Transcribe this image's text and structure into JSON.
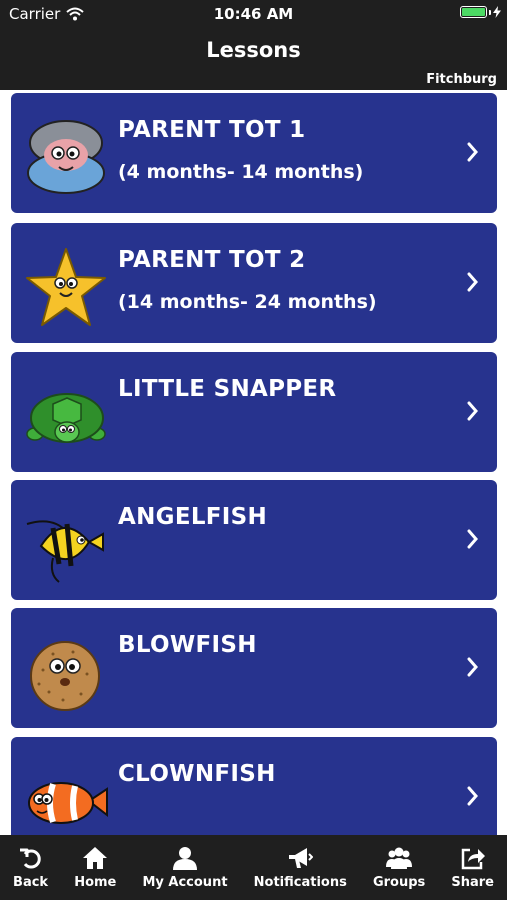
{
  "status_bar": {
    "carrier": "Carrier",
    "time": "10:46 AM",
    "battery_color": "#4cd964"
  },
  "nav": {
    "title": "Lessons",
    "location": "Fitchburg"
  },
  "lessons": [
    {
      "title": "PARENT TOT 1",
      "subtitle": "(4 months- 14 months)",
      "icon": "clam-icon"
    },
    {
      "title": "PARENT TOT 2",
      "subtitle": "(14 months- 24 months)",
      "icon": "starfish-icon"
    },
    {
      "title": "LITTLE SNAPPER",
      "subtitle": "",
      "icon": "turtle-icon"
    },
    {
      "title": "ANGELFISH",
      "subtitle": "",
      "icon": "angelfish-icon"
    },
    {
      "title": "BLOWFISH",
      "subtitle": "",
      "icon": "blowfish-icon"
    },
    {
      "title": "CLOWNFISH",
      "subtitle": "",
      "icon": "clownfish-icon"
    }
  ],
  "tabs": [
    {
      "label": "Back",
      "icon": "back-icon"
    },
    {
      "label": "Home",
      "icon": "home-icon"
    },
    {
      "label": "My Account",
      "icon": "user-icon"
    },
    {
      "label": "Notifications",
      "icon": "megaphone-icon"
    },
    {
      "label": "Groups",
      "icon": "groups-icon"
    },
    {
      "label": "Share",
      "icon": "share-icon"
    }
  ],
  "colors": {
    "bar_background": "#1f1f1f",
    "card_background": "#27338e",
    "text": "#ffffff"
  }
}
